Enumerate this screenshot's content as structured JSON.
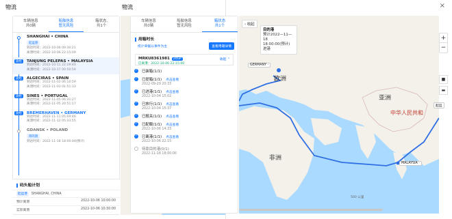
{
  "left_panel": {
    "title": "物流",
    "tabs": [
      {
        "line1": "车辆信息",
        "line2": "共0辆"
      },
      {
        "line1": "船舶信息",
        "line2": "暂无风险"
      },
      {
        "line1": "箱状态,",
        "line2": "共1个"
      }
    ],
    "stops": [
      {
        "name": "SHANGHAI • CHINA",
        "tag": "起运港",
        "badge": "",
        "times": [
          "到达时间：2022-10-06 09:30:21",
          "离港时间：2022-10-06 22:15:09"
        ]
      },
      {
        "name": "TANJUNG PELEPAS • MALAYSIA",
        "tag": "",
        "badge": "途经",
        "times": [
          "到达时间：2022-10-11 22:29:40",
          "离港时间：2022-10-17 00:50:59"
        ]
      },
      {
        "name": "ALGECIRAS • SPAIN",
        "tag": "",
        "badge": "途经",
        "times": [
          "到达时间：2022-11-02 06:10:59",
          "离港时间：2022-11-03 01:51:33"
        ]
      },
      {
        "name": "SINES • PORTUGAL",
        "tag": "",
        "badge": "途经",
        "times": [
          "到达时间：2022-11-05 06:31:27",
          "离港时间：2022-11-05 20:51:17"
        ]
      },
      {
        "name": "BREMERHAVEN • GERMANY",
        "tag": "",
        "badge": "途经",
        "times": [
          "到达时间：2022-11-11 05:09:46",
          "离港时间：2022-11-12 05:33:55"
        ]
      },
      {
        "name": "GDANSK • POLAND",
        "tag": "目的港",
        "badge": "",
        "times": [
          "到达时间：2022-11-18 18:00:00(预计)"
        ]
      }
    ],
    "plan": {
      "title": "码头船计划",
      "port_tag": "起运港",
      "port": "SHANGHAI, CHINA",
      "rows": [
        {
          "k": "预计离港",
          "v": "2022-10-06 10:00:00"
        },
        {
          "k": "实际离港",
          "v": "2022-10-06 10:30:00"
        }
      ]
    }
  },
  "right_panel": {
    "title": "物流",
    "close": "×",
    "tabs": [
      {
        "line1": "车辆信息",
        "line2": "共0辆"
      },
      {
        "line1": "船舶信息",
        "line2": "暂无风险"
      },
      {
        "line1": "箱状态",
        "line2": "共1个"
      }
    ],
    "section_title": "用箱时长",
    "note": "统计单据以事件为主",
    "view_btn": "查看用箱详情",
    "container": {
      "no": "MRKU8361981",
      "size": "20GP",
      "arrived": "已离港：2022-10-06 22:15:00",
      "fold": "收起 ⌃"
    },
    "events": [
      {
        "title": "已装箱(1/1)",
        "link": "",
        "date": ""
      },
      {
        "title": "已提箱(1/1)",
        "link": "点击查看",
        "date": "2022-09-29 20:33"
      },
      {
        "title": "已进港(1/1)",
        "link": "点击查看",
        "date": "2022-10-04 15:02"
      },
      {
        "title": "已放行(1/1)",
        "link": "点击查看",
        "date": "2022-10-04 15:37"
      },
      {
        "title": "已报关(1/1)",
        "link": "点击查看",
        "date": ""
      },
      {
        "title": "已配载(1/1)",
        "link": "点击查看",
        "date": "2022-10-06 14:33"
      },
      {
        "title": "已离港(1/1)",
        "link": "点击查看",
        "date": "2022-10-06 22:15"
      },
      {
        "title": "待靠目的港(0/1)",
        "link": "",
        "date": "2022-11-18 18:00:00"
      }
    ]
  },
  "map": {
    "collapse": "收起",
    "popup": {
      "title": "目的港",
      "line1": "预计2022—11—",
      "line2": "18",
      "line3": "18:00:00(预计)",
      "line4": "进港"
    },
    "labels": {
      "europe": "欧洲",
      "asia": "亚洲",
      "africa": "非洲",
      "china": "中华人民共和",
      "start": "起运"
    },
    "chips": {
      "germany": "GERMANY ·",
      "malaysia": "MALAYSIA ·"
    },
    "zoom_in": "+",
    "zoom_out": "−",
    "scale": "500 公里",
    "colors": {
      "sea": "#aadaff",
      "land": "#f3f1ea",
      "route": "#2f6fe4",
      "border": "#d9b8b8"
    }
  }
}
